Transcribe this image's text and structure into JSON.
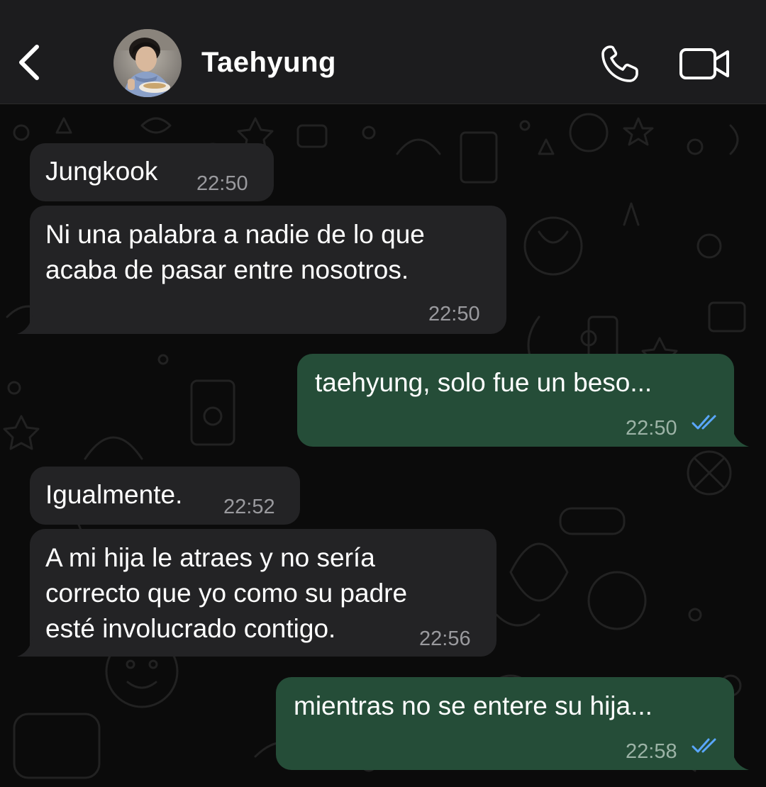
{
  "header": {
    "contact_name": "Taehyung"
  },
  "icons": {
    "back": "chevron-left-icon",
    "call": "phone-icon",
    "video": "video-camera-icon",
    "read": "double-check-icon"
  },
  "colors": {
    "header_bg": "#1c1c1e",
    "incoming_bubble": "#232325",
    "outgoing_bubble": "#254d38",
    "read_ticks": "#5aa7ff"
  },
  "messages": [
    {
      "direction": "incoming",
      "text": "Jungkook",
      "time": "22:50"
    },
    {
      "direction": "incoming",
      "text_lines": [
        "Ni una palabra a nadie de lo que",
        "acaba de pasar entre nosotros."
      ],
      "time": "22:50"
    },
    {
      "direction": "outgoing",
      "text": "taehyung, solo fue un beso...",
      "time": "22:50",
      "status": "read"
    },
    {
      "direction": "incoming",
      "text": "Igualmente.",
      "time": "22:52"
    },
    {
      "direction": "incoming",
      "text_lines": [
        "A mi hija le atraes y no sería",
        "correcto que yo como su padre",
        "esté involucrado contigo."
      ],
      "time": "22:56"
    },
    {
      "direction": "outgoing",
      "text": "mientras no se entere su hija...",
      "time": "22:58",
      "status": "read"
    }
  ]
}
